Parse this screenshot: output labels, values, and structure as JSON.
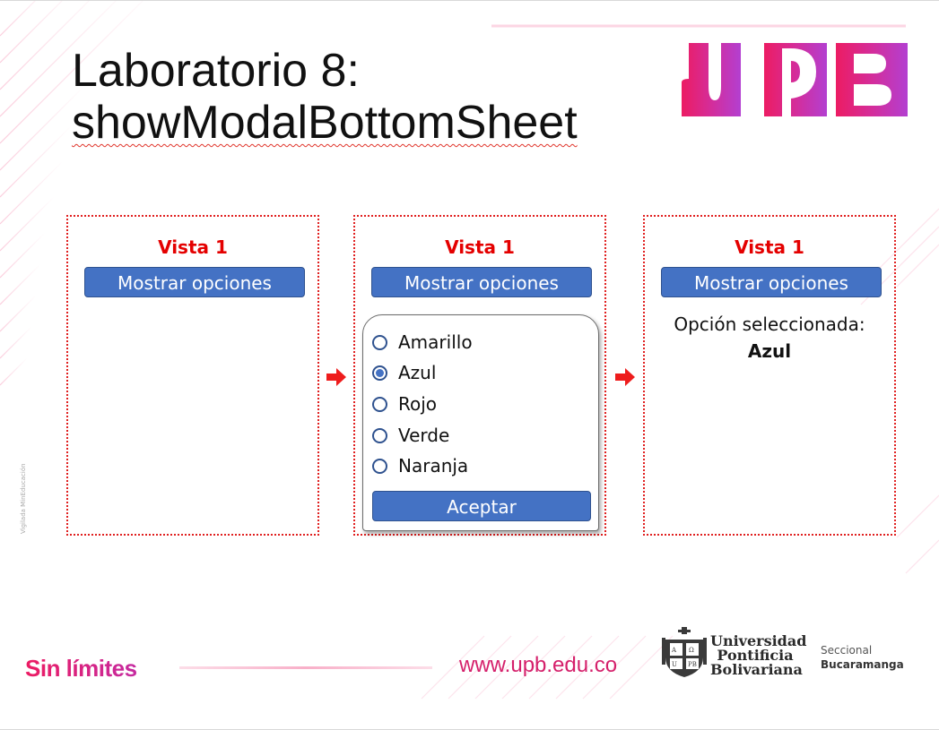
{
  "slide": {
    "title_line1": "Laboratorio 8:",
    "title_line2": "showModalBottomSheet",
    "logo_text": "UPB",
    "vigilada": "Vigilada MinEducación"
  },
  "panels": [
    {
      "vista": "Vista 1",
      "button": "Mostrar opciones"
    },
    {
      "vista": "Vista 1",
      "button": "Mostrar opciones",
      "sheet": {
        "options": [
          "Amarillo",
          "Azul",
          "Rojo",
          "Verde",
          "Naranja"
        ],
        "selected": "Azul",
        "accept": "Aceptar"
      }
    },
    {
      "vista": "Vista 1",
      "button": "Mostrar opciones",
      "result_label": "Opción seleccionada:",
      "result_value": "Azul"
    }
  ],
  "footer": {
    "slogan": "Sin límites",
    "url": "www.upb.edu.co",
    "university": [
      "Universidad",
      "Pontificia",
      "Bolivariana"
    ],
    "seccional_label": "Seccional",
    "seccional_city": "Bucaramanga"
  },
  "colors": {
    "accent_red": "#e40000",
    "button_blue": "#4472c4",
    "brand_pink": "#ec1c63",
    "brand_purple": "#b33fd1"
  }
}
